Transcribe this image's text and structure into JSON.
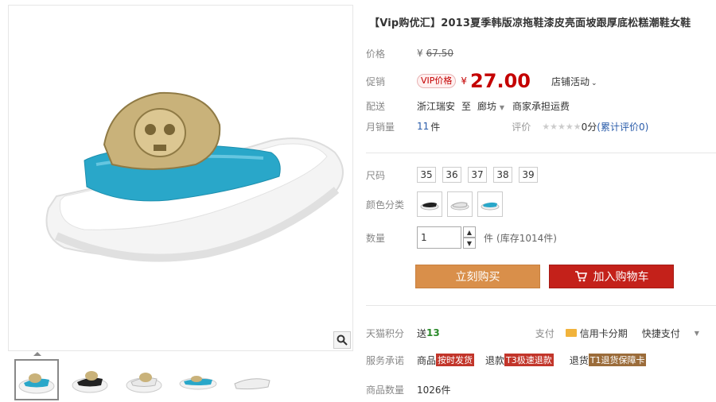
{
  "title": "【Vip购优汇】2013夏季韩版凉拖鞋漆皮亮面坡跟厚底松糕潮鞋女鞋",
  "price": {
    "label": "价格",
    "currency": "¥",
    "original": "67.50"
  },
  "promo": {
    "label": "促销",
    "vip_tag": "VIP价格",
    "currency": "¥",
    "price": "27.00",
    "activity": "店铺活动"
  },
  "shipping": {
    "label": "配送",
    "from": "浙江瑞安",
    "to_word": "至",
    "dest": "廊坊",
    "note": "商家承担运费"
  },
  "sales": {
    "label": "月销量",
    "value": "11",
    "unit": "件",
    "rating_label": "评价",
    "rating_score": "0分",
    "rating_count": "(累计评价0)"
  },
  "size": {
    "label": "尺码",
    "options": [
      "35",
      "36",
      "37",
      "38",
      "39"
    ]
  },
  "color": {
    "label": "颜色分类"
  },
  "quantity": {
    "label": "数量",
    "value": "1",
    "unit": "件",
    "stock": "(库存1014件)"
  },
  "buttons": {
    "buy_now": "立刻购买",
    "add_cart": "加入购物车"
  },
  "points": {
    "label": "天猫积分",
    "prefix": "送",
    "value": "13"
  },
  "payment": {
    "label": "支付",
    "credit": "信用卡分期",
    "quick": "快捷支付"
  },
  "service": {
    "label": "服务承诺",
    "goods_label": "商品",
    "goods_tag": "按时发货",
    "refund_label": "退款",
    "refund_tag": "T3极速退款",
    "return_label": "退货",
    "return_tag": "T1退货保障卡"
  },
  "goods_count": {
    "label": "商品数量",
    "value": "1026件"
  },
  "colors": {
    "accent": "#c40000",
    "buy": "#d98f4a",
    "cart": "#c4211a",
    "shoe_blue": "#29a7c9"
  }
}
